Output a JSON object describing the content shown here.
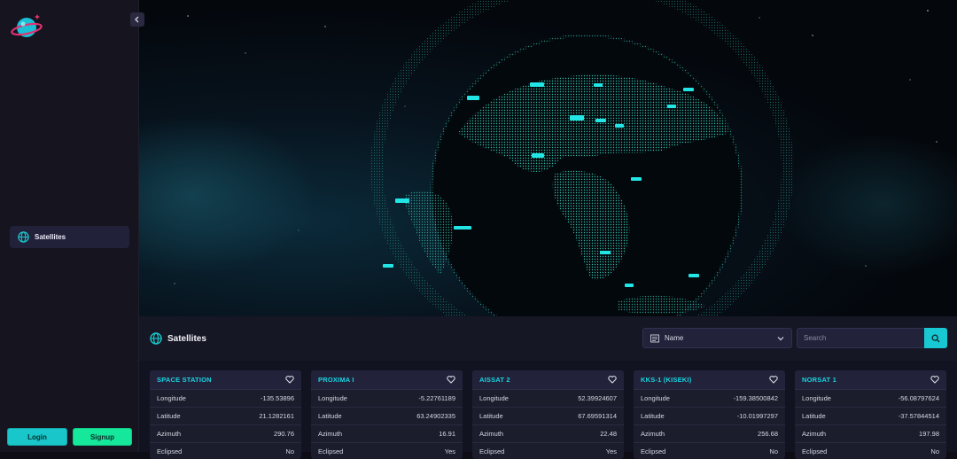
{
  "sidebar": {
    "nav": [
      {
        "label": "Satellites",
        "icon": "globe-icon",
        "active": true
      }
    ],
    "login_label": "Login",
    "signup_label": "Signup"
  },
  "panel": {
    "title": "Satellites",
    "sort": {
      "value": "Name",
      "icon": "list-icon"
    },
    "search": {
      "placeholder": "Search"
    }
  },
  "field_labels": {
    "longitude": "Longitude",
    "latitude": "Latitude",
    "azimuth": "Azimuth",
    "eclipsed": "Eclipsed"
  },
  "satellites": [
    {
      "name": "SPACE STATION",
      "longitude": "-135.53896",
      "latitude": "21.1282161",
      "azimuth": "290.76",
      "eclipsed": "No"
    },
    {
      "name": "PROXIMA I",
      "longitude": "-5.22761189",
      "latitude": "63.24902335",
      "azimuth": "16.91",
      "eclipsed": "Yes"
    },
    {
      "name": "AISSAT 2",
      "longitude": "52.39924607",
      "latitude": "67.69591314",
      "azimuth": "22.48",
      "eclipsed": "Yes"
    },
    {
      "name": "KKS-1 (KISEKI)",
      "longitude": "-159.38500842",
      "latitude": "-10.01997297",
      "azimuth": "256.68",
      "eclipsed": "No"
    },
    {
      "name": "NORSAT 1",
      "longitude": "-56.08797624",
      "latitude": "-37.57844514",
      "azimuth": "197.98",
      "eclipsed": "No"
    }
  ],
  "colors": {
    "accent": "#1ad3e2",
    "signup": "#15e89a",
    "login": "#19c6c9",
    "background": "#0e0d15"
  }
}
